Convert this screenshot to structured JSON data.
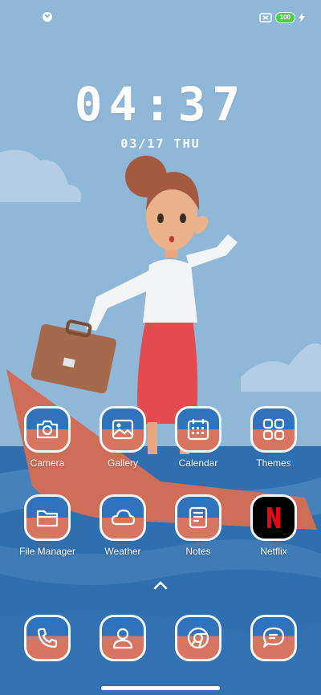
{
  "status_bar": {
    "left_icon": "app-notification-icon",
    "battery_level": "100",
    "icons": [
      "sim-off-icon",
      "battery-icon",
      "charging-bolt-icon"
    ]
  },
  "lock": {
    "time": "04:37",
    "date": "03/17 THU"
  },
  "apps_row1": [
    {
      "label": "Camera",
      "icon": "camera-icon"
    },
    {
      "label": "Gallery",
      "icon": "gallery-icon"
    },
    {
      "label": "Calendar",
      "icon": "calendar-icon"
    },
    {
      "label": "Themes",
      "icon": "themes-icon"
    }
  ],
  "apps_row2": [
    {
      "label": "File Manager",
      "icon": "folder-icon"
    },
    {
      "label": "Weather",
      "icon": "cloud-icon"
    },
    {
      "label": "Notes",
      "icon": "notes-icon"
    },
    {
      "label": "Netflix",
      "icon": "netflix-icon",
      "brand_color": "#e50914"
    }
  ],
  "dock": [
    {
      "icon": "phone-icon"
    },
    {
      "icon": "contacts-icon"
    },
    {
      "icon": "chrome-icon"
    },
    {
      "icon": "messages-icon"
    }
  ],
  "colors": {
    "sky": "#8fb7d8",
    "sea": "#2f6fb0",
    "boat": "#d87560",
    "accent_battery": "#44d14a"
  }
}
